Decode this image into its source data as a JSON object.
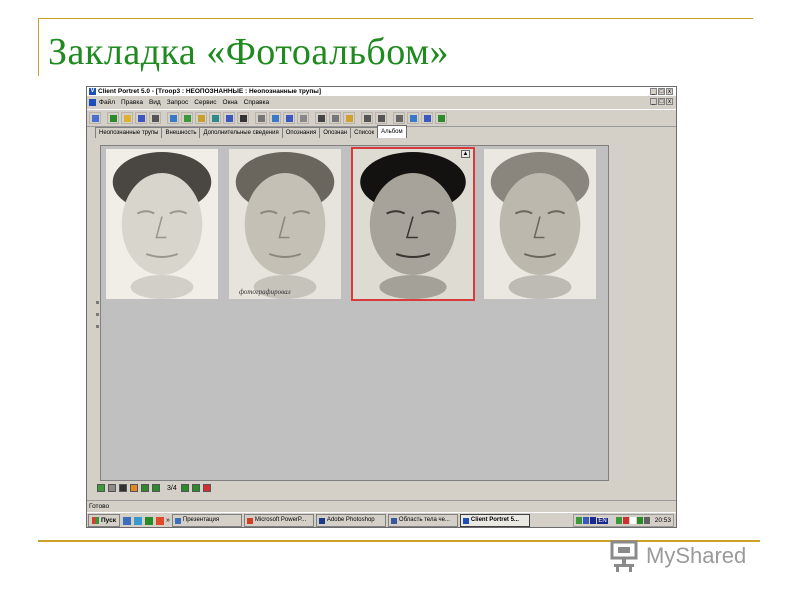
{
  "slide": {
    "title": "Закладка «Фотоальбом»",
    "logo_text": "MyShared"
  },
  "window": {
    "app_icon_letter": "V",
    "title": "Client Portret 5.0 - [Тгоор3 : НЕОПОЗНАННЫЕ : Неопознанные трупы]",
    "controls": [
      "_",
      "□",
      "x"
    ]
  },
  "menu": {
    "items": [
      "Файл",
      "Правка",
      "Вид",
      "Запрос",
      "Сервис",
      "Окна",
      "Справка"
    ]
  },
  "toolbar": {
    "buttons": [
      {
        "icon": "window-icon",
        "color": "#4a6fd0"
      },
      {
        "icon": "arrow-icon",
        "color": "#2b8a2b"
      },
      {
        "icon": "open-folder-icon",
        "color": "#e0b030"
      },
      {
        "icon": "save-icon",
        "color": "#3a58c0"
      },
      {
        "icon": "search-person-icon",
        "color": "#555555"
      },
      {
        "icon": "form-icon",
        "color": "#3a78c8"
      },
      {
        "icon": "person-green-icon",
        "color": "#3a9a3a"
      },
      {
        "icon": "person-yellow-icon",
        "color": "#c8a030"
      },
      {
        "icon": "person-double-icon",
        "color": "#2e8a8a"
      },
      {
        "icon": "person-blue-icon",
        "color": "#3a58c0"
      },
      {
        "icon": "stop-icon",
        "color": "#333333"
      },
      {
        "icon": "find-icon",
        "color": "#777777"
      },
      {
        "icon": "list-icon",
        "color": "#3a78c8"
      },
      {
        "icon": "grid-icon",
        "color": "#3a58c0"
      },
      {
        "icon": "panel-icon",
        "color": "#888888"
      },
      {
        "icon": "cut-icon",
        "color": "#444444"
      },
      {
        "icon": "copy-icon",
        "color": "#777777"
      },
      {
        "icon": "paste-icon",
        "color": "#d0a030"
      },
      {
        "icon": "undo-icon",
        "color": "#555555"
      },
      {
        "icon": "redo-icon",
        "color": "#555555"
      },
      {
        "icon": "print-icon",
        "color": "#666666"
      },
      {
        "icon": "preview-icon",
        "color": "#3a78c8"
      },
      {
        "icon": "export-icon",
        "color": "#3a58c0"
      },
      {
        "icon": "help-icon",
        "color": "#2e8a2e"
      }
    ]
  },
  "tabs": [
    {
      "label": "Неопознанные трупы",
      "active": false
    },
    {
      "label": "Внешность",
      "active": false
    },
    {
      "label": "Дополнительные сведения",
      "active": false
    },
    {
      "label": "Опознания",
      "active": false
    },
    {
      "label": "Опознан",
      "active": false
    },
    {
      "label": "Список",
      "active": false
    },
    {
      "label": "Альбом",
      "active": true
    }
  ],
  "album": {
    "photos": [
      {
        "name": "photo-1",
        "bg": "#f0eee6",
        "face": "#d8d5cc",
        "hair": "#4a4742",
        "shade": "#9a968e",
        "selected": false,
        "caption": ""
      },
      {
        "name": "photo-2",
        "bg": "#e6e4dc",
        "face": "#c4c0b6",
        "hair": "#6a665e",
        "shade": "#8a867e",
        "selected": false,
        "caption": "фотографировал"
      },
      {
        "name": "photo-3",
        "bg": "#dedbd2",
        "face": "#a8a39a",
        "hair": "#141210",
        "shade": "#3a3632",
        "selected": true,
        "caption": ""
      },
      {
        "name": "photo-4",
        "bg": "#eae8e0",
        "face": "#bcb8ae",
        "hair": "#8a867e",
        "shade": "#6a665e",
        "selected": false,
        "caption": ""
      }
    ],
    "selected_icon": "person-badge-icon"
  },
  "navigation": {
    "page": "3/4",
    "buttons": [
      {
        "icon": "leaf-icon",
        "color": "#3a9a3a"
      },
      {
        "icon": "document-icon",
        "color": "#8a8a8a"
      },
      {
        "icon": "dropdown-arrow-icon",
        "color": "#333333"
      },
      {
        "icon": "orange-box-icon",
        "color": "#e08a20"
      },
      {
        "icon": "first-page-icon",
        "color": "#2a8a2a"
      },
      {
        "icon": "prev-page-icon",
        "color": "#2a8a2a"
      },
      {
        "icon": "next-page-icon",
        "color": "#2a8a2a"
      },
      {
        "icon": "last-page-icon",
        "color": "#2a8a2a"
      },
      {
        "icon": "delete-icon",
        "color": "#d03030"
      }
    ]
  },
  "status": {
    "text": "Готово"
  },
  "taskbar": {
    "start_label": "Пуск",
    "quicklaunch_more": "»",
    "tasks": [
      {
        "label": "Презентация",
        "color": "#3a6fc0",
        "active": false
      },
      {
        "label": "Microsoft PowerP...",
        "color": "#d04020",
        "active": false
      },
      {
        "label": "Adobe Photoshop",
        "color": "#1a3a8a",
        "active": false
      },
      {
        "label": "Область тела че...",
        "color": "#3a58a0",
        "active": false
      },
      {
        "label": "Client Portret 5...",
        "color": "#1d4fb8",
        "active": true
      }
    ],
    "tray_icons": [
      "#3a9a3a",
      "#3a58c0",
      "#1a2a8a",
      "#d0d0d0",
      "#3a9a3a",
      "#d03030",
      "#ffffff",
      "#2a8a2a",
      "#606060"
    ],
    "lang": "EN",
    "clock": "20:53"
  }
}
